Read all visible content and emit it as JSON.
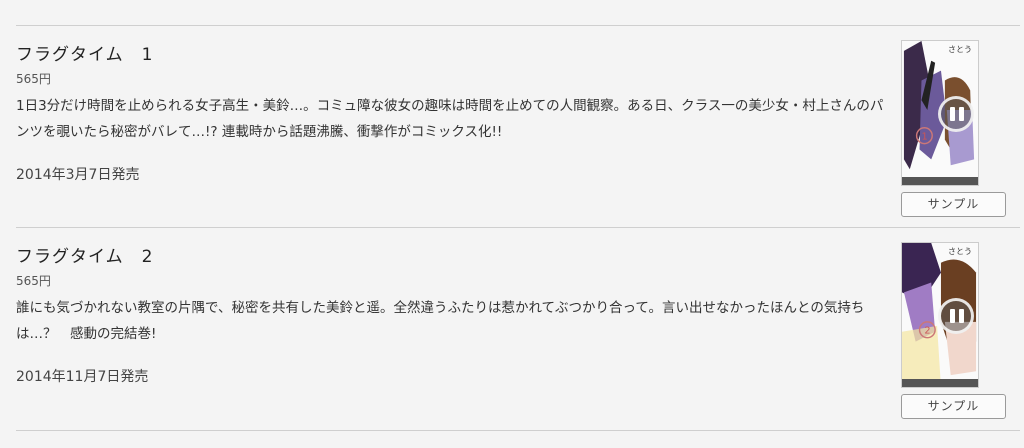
{
  "items": [
    {
      "title": "フラグタイム　1",
      "price": "565円",
      "description": "1日3分だけ時間を止められる女子高生・美鈴…。コミュ障な彼女の趣味は時間を止めての人間観察。ある日、クラス一の美少女・村上さんのパンツを覗いたら秘密がバレて…!? 連載時から話題沸騰、衝撃作がコミックス化!!",
      "release_date": "2014年3月7日発売",
      "cover": {
        "author": "さとう",
        "badge_icon": "play-pause-icon"
      },
      "sample_label": "サンプル"
    },
    {
      "title": "フラグタイム　2",
      "price": "565円",
      "description": "誰にも気づかれない教室の片隅で、秘密を共有した美鈴と遥。全然違うふたりは惹かれてぶつかり合って。言い出せなかったほんとの気持ちは…？　感動の完結巻!",
      "release_date": "2014年11月7日発売",
      "cover": {
        "author": "さとう",
        "badge_icon": "play-pause-icon"
      },
      "sample_label": "サンプル"
    }
  ],
  "colors": {
    "background": "#f4f4f4",
    "divider": "#cfcfcf",
    "cover_accent": "#b48ad6"
  }
}
